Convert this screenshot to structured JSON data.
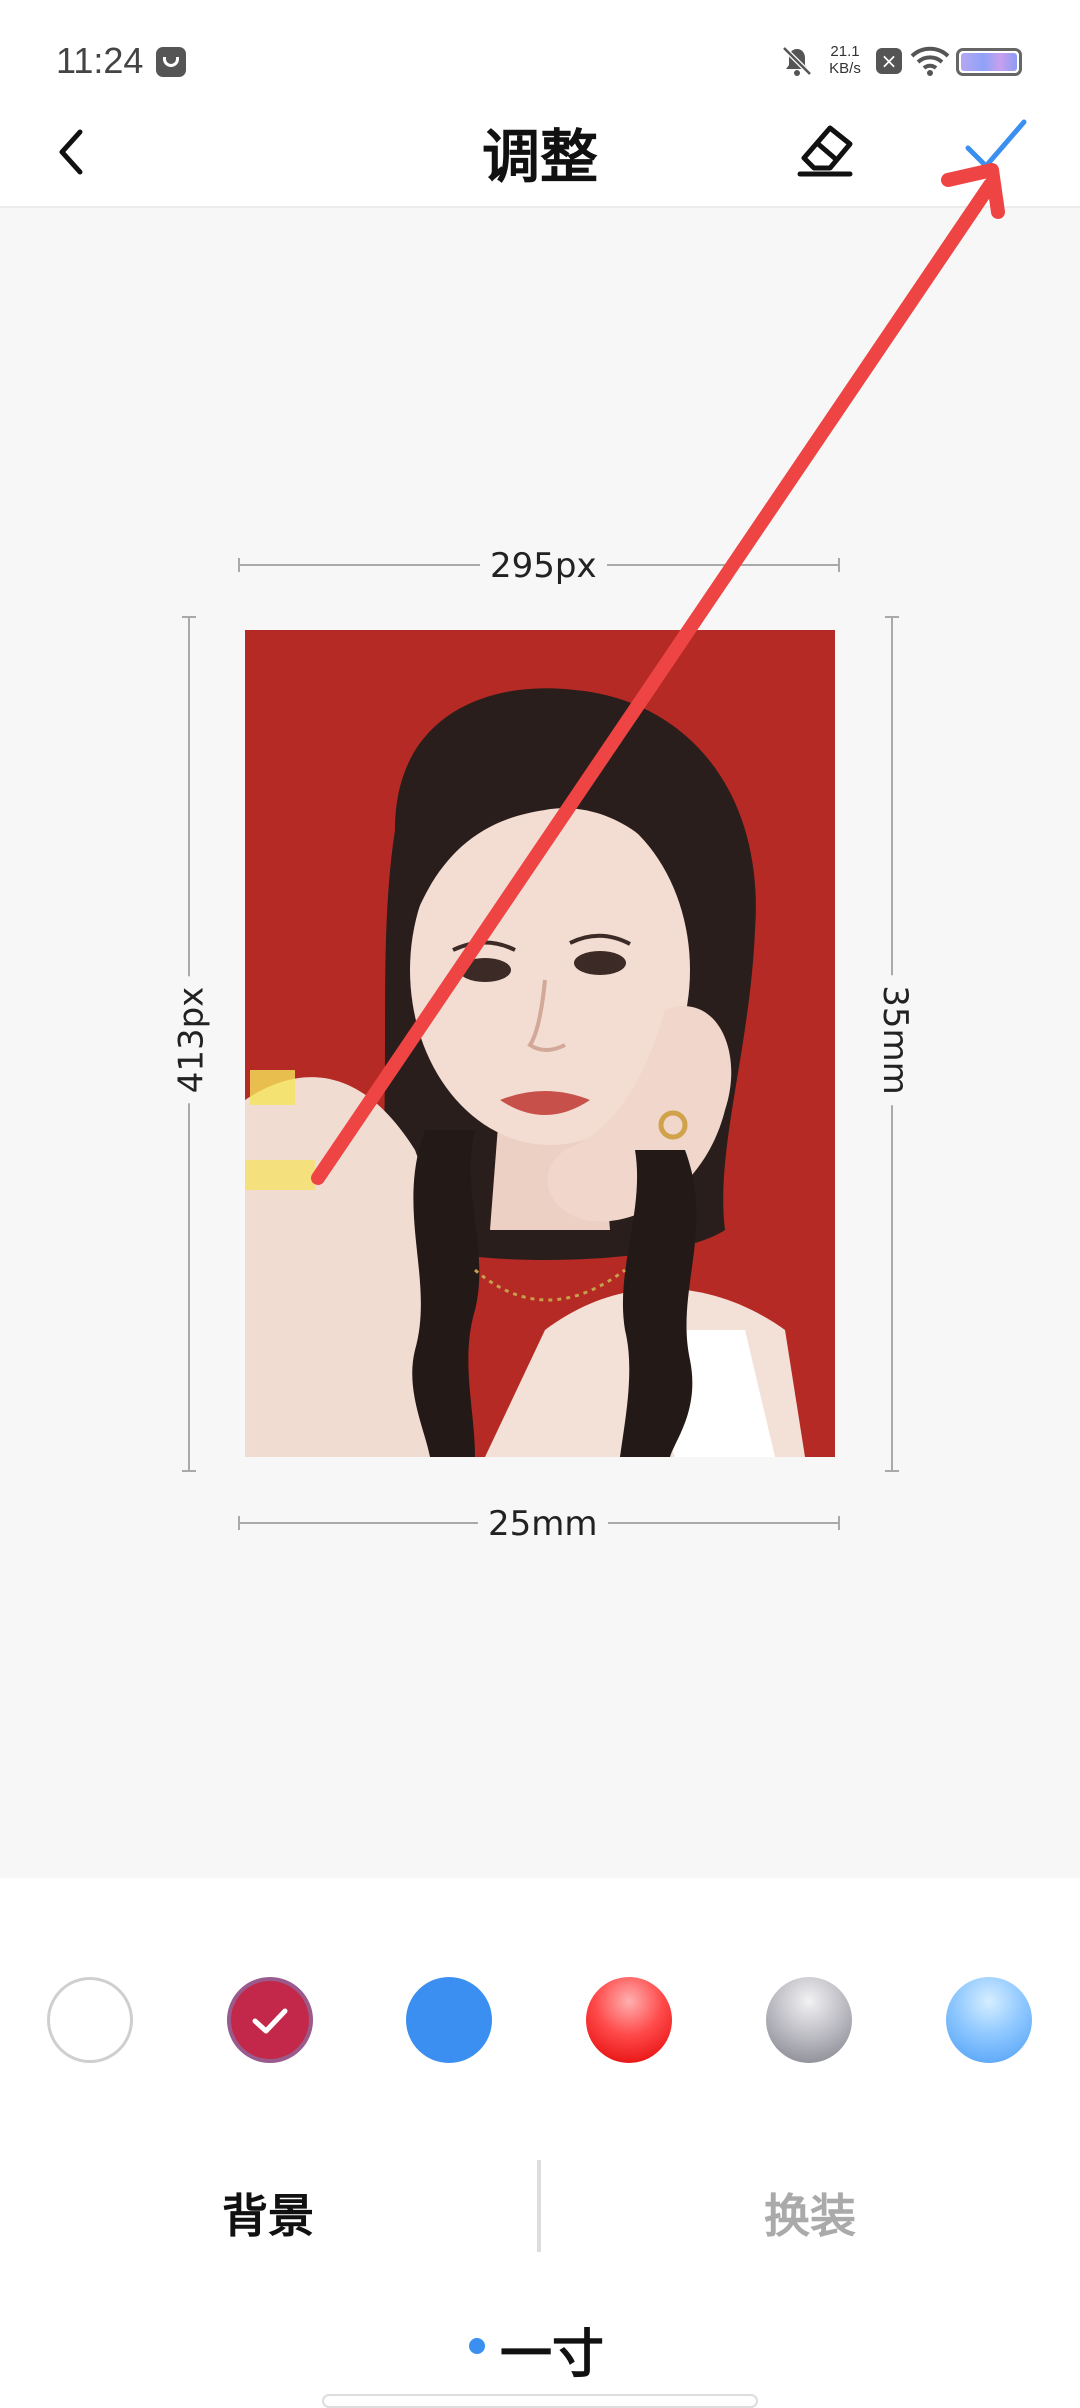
{
  "status_bar": {
    "time": "11:24",
    "speed_value": "21.1",
    "speed_unit": "KB/s",
    "icons": [
      "notification-app-icon",
      "bell-muted-icon",
      "x-box-icon",
      "wifi-icon",
      "battery-icon"
    ]
  },
  "header": {
    "title": "调整",
    "back_icon": "chevron-left-icon",
    "eraser_icon": "eraser-icon",
    "confirm_icon": "check-icon",
    "confirm_color": "#3a8ff0"
  },
  "photo": {
    "width_px": "295px",
    "height_px": "413px",
    "width_mm": "25mm",
    "height_mm": "35mm",
    "background_color": "#b52a24"
  },
  "swatches": [
    {
      "name": "white",
      "color": "#ffffff",
      "selected": false
    },
    {
      "name": "crimson",
      "color": "#c3284a",
      "selected": true
    },
    {
      "name": "blue",
      "color": "#3a8ff0",
      "selected": false
    },
    {
      "name": "red-gradient",
      "color": "#ff2a2a",
      "selected": false
    },
    {
      "name": "gray-gradient",
      "color": "#a7a7b0",
      "selected": false
    },
    {
      "name": "light-blue-gradient",
      "color": "#8fc8ff",
      "selected": false
    }
  ],
  "tabs": [
    {
      "label": "背景",
      "active": true
    },
    {
      "label": "换装",
      "active": false
    }
  ],
  "size": {
    "label": "一寸"
  },
  "annotation": {
    "arrow_color": "#ee4444"
  }
}
